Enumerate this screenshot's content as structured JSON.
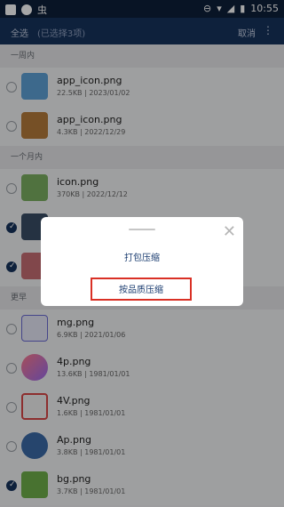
{
  "status_bar": {
    "left_text": "虫",
    "time": "10:55",
    "icons": [
      "square-icon",
      "circle-icon",
      "dnd-icon",
      "wifi-icon",
      "signal-icon",
      "battery-icon"
    ]
  },
  "app_bar": {
    "select_all": "全选",
    "selected_count": "(已选择3项)",
    "cancel": "取消",
    "more_icon": "more-vert-icon"
  },
  "sections": [
    {
      "title": "一周内",
      "items": [
        {
          "name": "app_icon.png",
          "meta": "22.5KB | 2023/01/02",
          "checked": false
        },
        {
          "name": "app_icon.png",
          "meta": "4.3KB | 2022/12/29",
          "checked": false
        }
      ]
    },
    {
      "title": "一个月内",
      "items": [
        {
          "name": "icon.png",
          "meta": "370KB | 2022/12/12",
          "checked": false
        },
        {
          "name": "",
          "meta": "",
          "checked": true
        },
        {
          "name": "",
          "meta": "",
          "checked": true
        }
      ]
    },
    {
      "title": "更早",
      "items": [
        {
          "name": "mg.png",
          "meta": "6.9KB | 2021/01/06",
          "checked": false
        },
        {
          "name": "4p.png",
          "meta": "13.6KB | 1981/01/01",
          "checked": false
        },
        {
          "name": "4V.png",
          "meta": "1.6KB | 1981/01/01",
          "checked": false
        },
        {
          "name": "Ap.png",
          "meta": "3.8KB | 1981/01/01",
          "checked": false
        },
        {
          "name": "bg.png",
          "meta": "3.7KB | 1981/01/01",
          "checked": true
        }
      ]
    }
  ],
  "modal": {
    "option_pack": "打包压缩",
    "option_quality": "按品质压缩",
    "close_icon": "close-icon"
  },
  "colors": {
    "app_bar": "#16335c",
    "status_bar": "#0d1f3a",
    "highlight": "#d93025",
    "check": "#16335c"
  }
}
